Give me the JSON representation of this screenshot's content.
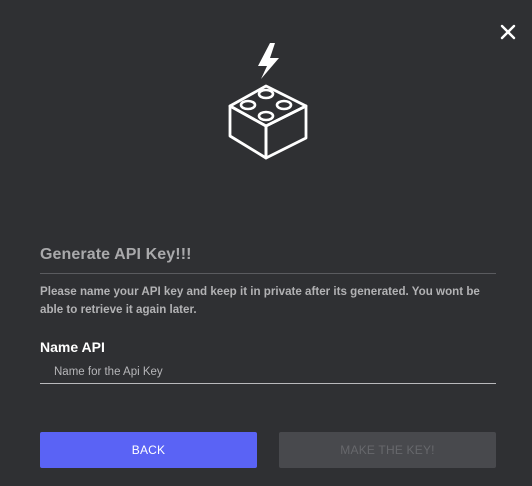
{
  "dialog": {
    "close_icon": "close-icon",
    "hero_icon": "api-block-bolt-icon",
    "title": "Generate API Key!!!",
    "description": "Please name your API key and keep it in private after its generated. You wont be able to retrieve it again later.",
    "field": {
      "label": "Name API",
      "placeholder": "Name for the Api Key",
      "value": ""
    },
    "buttons": {
      "back_label": "BACK",
      "make_label": "MAKE THE KEY!",
      "make_disabled": true
    }
  },
  "colors": {
    "background": "#2f3033",
    "accent": "#5a63f5",
    "disabled_button": "#48494d"
  }
}
